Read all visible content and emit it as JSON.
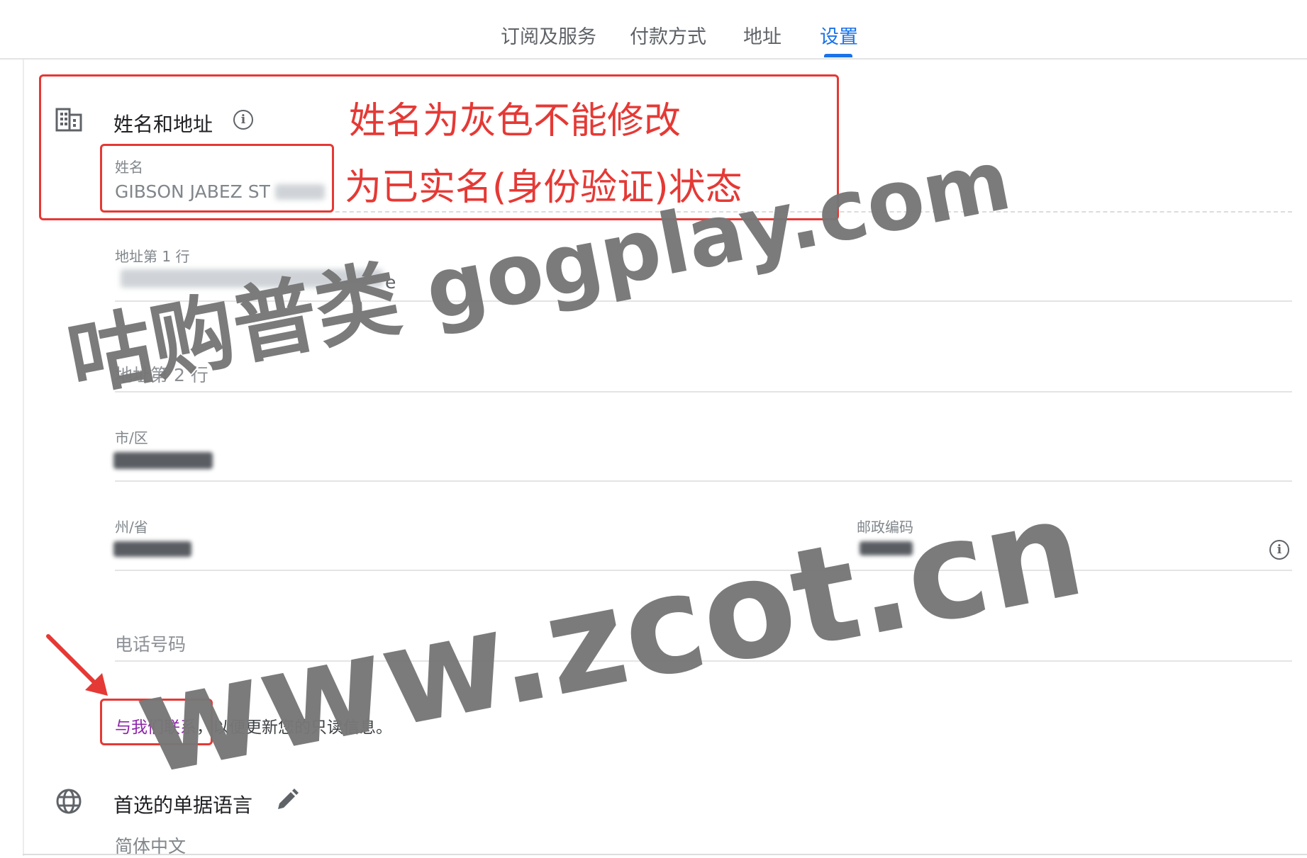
{
  "tabs": [
    {
      "label": "订阅及服务"
    },
    {
      "label": "付款方式"
    },
    {
      "label": "地址"
    },
    {
      "label": "设置"
    }
  ],
  "name_address": {
    "title": "姓名和地址",
    "name_label": "姓名",
    "name_value": "GIBSON JABEZ ST",
    "address1_label": "地址第 1 行",
    "address1_suffix": "e",
    "address2_placeholder": "地址第 2 行",
    "city_label": "市/区",
    "state_label": "州/省",
    "postal_label": "邮政编码",
    "phone_placeholder": "电话号码",
    "contact_link": "与我们联系",
    "contact_rest": "，以便更新您的只读信息。"
  },
  "language": {
    "title": "首选的单据语言",
    "value": "简体中文"
  },
  "annotations": {
    "line1": "姓名为灰色不能修改",
    "line2": "为已实名(身份验证)状态"
  },
  "watermarks": {
    "text1": "咕购普类 gogplay.com",
    "text2": "www.zcot.cn"
  },
  "colors": {
    "accent": "#1a73e8",
    "annotation_red": "#e53935",
    "link_purple": "#8e24aa",
    "watermark_gray": "#777777"
  },
  "icons": [
    "building-icon",
    "info-icon",
    "globe-icon",
    "edit-icon",
    "red-arrow-icon"
  ]
}
